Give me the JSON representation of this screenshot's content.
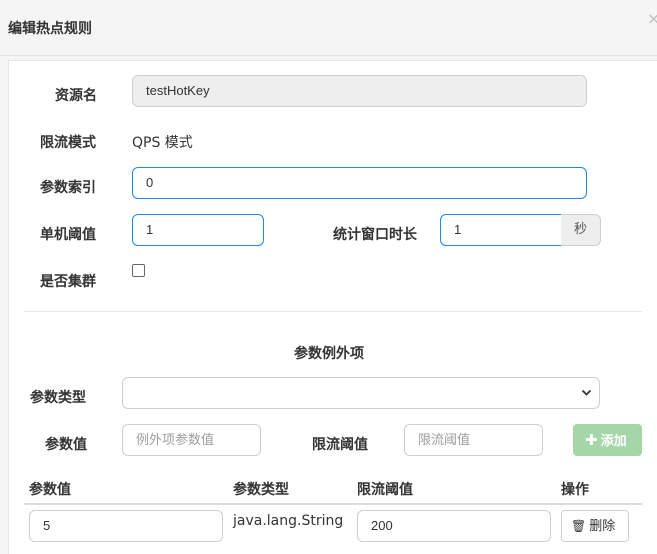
{
  "dialog": {
    "title": "编辑热点规则",
    "close_label": "×"
  },
  "form": {
    "resource_label": "资源名",
    "resource_value": "testHotKey",
    "mode_label": "限流模式",
    "mode_value": "QPS 模式",
    "param_index_label": "参数索引",
    "param_index_value": "0",
    "threshold_label": "单机阈值",
    "threshold_value": "1",
    "window_label": "统计窗口时长",
    "window_value": "1",
    "window_unit": "秒",
    "cluster_label": "是否集群",
    "cluster_checked": false
  },
  "exception": {
    "section_title": "参数例外项",
    "param_type_label": "参数类型",
    "param_type_value": "",
    "param_value_label": "参数值",
    "param_value_placeholder": "例外项参数值",
    "limit_label": "限流阈值",
    "limit_placeholder": "限流阈值",
    "add_button": "添加"
  },
  "table": {
    "columns": [
      "参数值",
      "参数类型",
      "限流阈值",
      "操作"
    ],
    "rows": [
      {
        "value": "5",
        "type": "java.lang.String",
        "threshold": "200",
        "action": "删除"
      }
    ]
  },
  "icons": {
    "close": "close-icon",
    "chevron": "chevron-down-icon",
    "plus": "plus-icon",
    "trash": "trash-icon"
  }
}
